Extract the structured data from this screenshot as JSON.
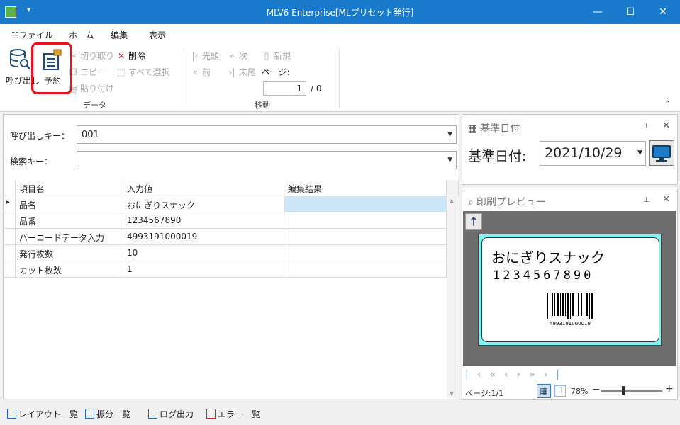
{
  "window": {
    "title": "MLV6 Enterprise[MLプリセット発行]",
    "minimize": "—",
    "maximize": "☐",
    "close": "✕",
    "qa_icon": "▾"
  },
  "menu": {
    "file": "ファイル",
    "file_icon": "☷",
    "home": "ホーム",
    "edit": "編集",
    "view": "表示"
  },
  "ribbon": {
    "call": "呼び出し",
    "reserve": "予約",
    "cut": "切り取り",
    "copy": "コピー",
    "paste": "貼り付け",
    "delete": "削除",
    "select_all": "すべて選択",
    "data_group": "データ",
    "first": "先頭",
    "next": "次",
    "new": "新規",
    "prev": "前",
    "last": "末尾",
    "page_label": "ページ:",
    "page_value": "1",
    "page_total": "/ 0",
    "move_group": "移動",
    "collapse": "⌃",
    "icons": {
      "cut": "✂",
      "copy": "❐",
      "paste": "▤",
      "delete": "✕",
      "select_all": "⬚",
      "first": "|‹",
      "next": "»",
      "new": "▯",
      "prev": "«",
      "last": "›|"
    }
  },
  "form": {
    "call_key_label": "呼び出しキー：",
    "call_key_value": "001",
    "search_key_label": "検索キー：",
    "search_key_value": "",
    "dropdown_arrow": "▼"
  },
  "grid": {
    "headers": [
      "項目名",
      "入力値",
      "編集結果"
    ],
    "row_indicator": "▸",
    "rows": [
      {
        "name": "品名",
        "value": "おにぎりスナック",
        "result": ""
      },
      {
        "name": "品番",
        "value": "1234567890",
        "result": ""
      },
      {
        "name": "バーコードデータ入力",
        "value": "4993191000019",
        "result": ""
      },
      {
        "name": "発行枚数",
        "value": "10",
        "result": ""
      },
      {
        "name": "カット枚数",
        "value": "1",
        "result": ""
      }
    ]
  },
  "date_panel": {
    "title": "基準日付",
    "label": "基準日付:",
    "value": "2021/10/29",
    "pin": "⊥",
    "close": "✕",
    "arrow": "▼"
  },
  "preview_panel": {
    "title": "印刷プレビュー",
    "pin": "⊥",
    "close": "✕",
    "up": "🡑",
    "label_name": "おにぎりスナック",
    "label_code": "1234567890",
    "barcode_text": "4993191000019",
    "nav": [
      "|‹",
      "«",
      "‹",
      "›",
      "»",
      "›|"
    ],
    "page_text": "ページ:1/1",
    "zoom": "78%",
    "zoom_minus": "−",
    "zoom_plus": "+",
    "zoom_level": 0.35
  },
  "statusbar": {
    "layout_list": "レイアウト一覧",
    "sort_list": "振分一覧",
    "log_output": "ログ出力",
    "error_list": "エラー一覧"
  }
}
